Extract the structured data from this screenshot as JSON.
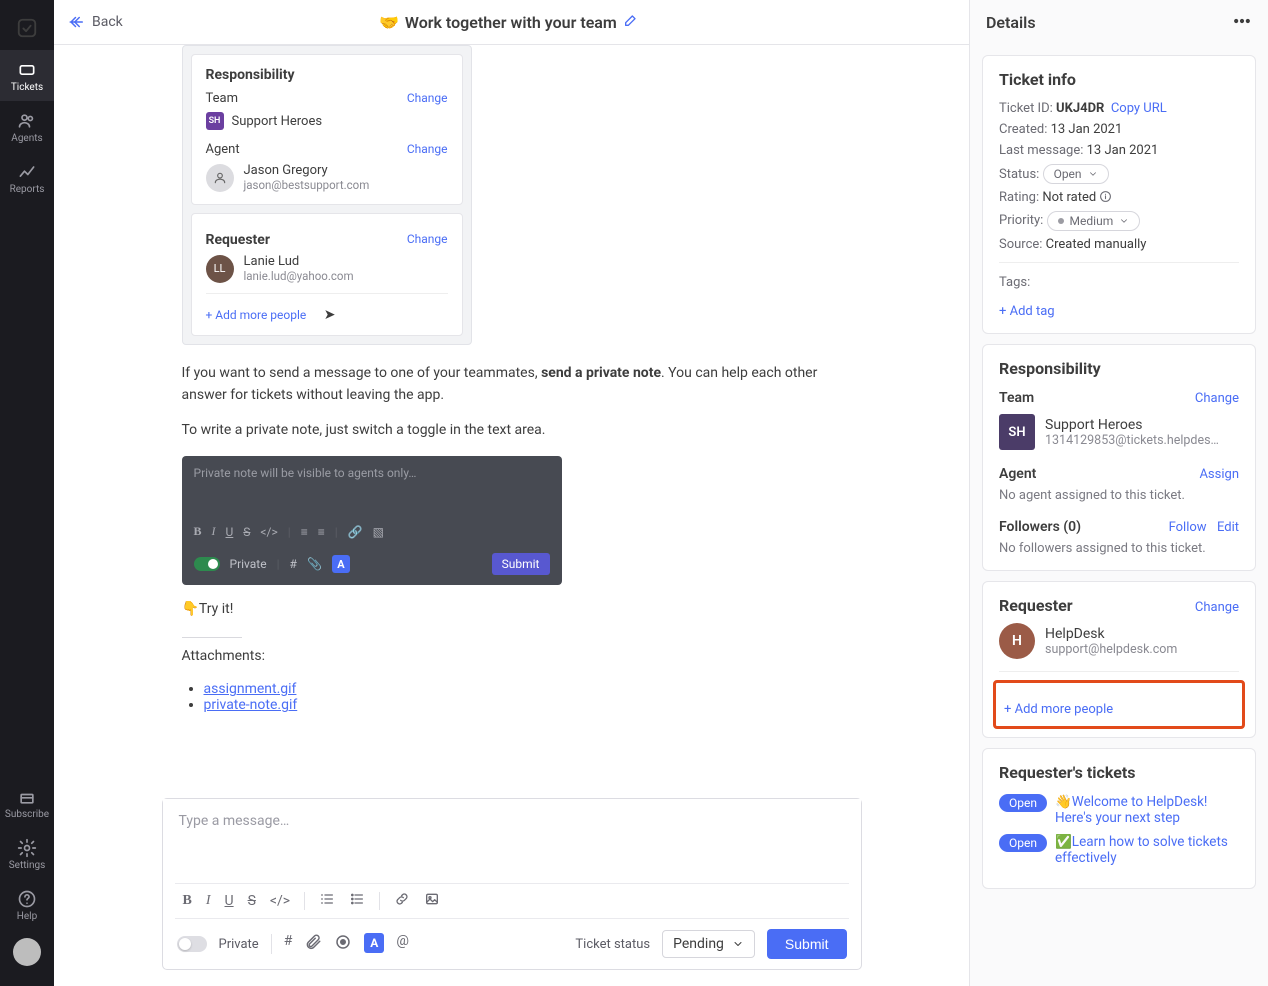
{
  "nav": {
    "items": [
      {
        "label": "Tickets"
      },
      {
        "label": "Agents"
      },
      {
        "label": "Reports"
      }
    ],
    "bottom": [
      {
        "label": "Subscribe"
      },
      {
        "label": "Settings"
      },
      {
        "label": "Help"
      }
    ]
  },
  "header": {
    "back": "Back",
    "emoji": "🤝",
    "title": "Work together with your team"
  },
  "embed1": {
    "heading": "Responsibility",
    "team_label": "Team",
    "team_name": "Support Heroes",
    "team_initials": "SH",
    "agent_label": "Agent",
    "agent_name": "Jason Gregory",
    "agent_email": "jason@bestsupport.com",
    "change": "Change"
  },
  "embed2": {
    "heading": "Requester",
    "name": "Lanie Lud",
    "initials": "LL",
    "email": "lanie.lud@yahoo.com",
    "change": "Change",
    "add_more": "+ Add more people"
  },
  "prose": {
    "p1a": "If you want to send a message to one of your teammates, ",
    "p1b": "send a private note",
    "p1c": ". You can help each other answer for tickets without leaving the app.",
    "p2": "To write a private note, just switch a toggle in the text area.",
    "try": "👇Try it!"
  },
  "private_box": {
    "placeholder": "Private note will be visible to agents only…",
    "private_label": "Private",
    "submit": "Submit"
  },
  "attachments": {
    "label": "Attachments:",
    "files": [
      "assignment.gif",
      "private-note.gif"
    ]
  },
  "composer": {
    "placeholder": "Type a message…",
    "private_label": "Private",
    "status_label": "Ticket status",
    "status_value": "Pending",
    "submit": "Submit"
  },
  "details": {
    "title": "Details",
    "ticket_info": {
      "heading": "Ticket info",
      "id_label": "Ticket ID:",
      "id_value": "UKJ4DR",
      "copy_url": "Copy URL",
      "created_label": "Created:",
      "created_value": "13 Jan 2021",
      "last_label": "Last message:",
      "last_value": "13 Jan 2021",
      "status_label": "Status:",
      "status_value": "Open",
      "rating_label": "Rating:",
      "rating_value": "Not rated",
      "priority_label": "Priority:",
      "priority_value": "Medium",
      "source_label": "Source:",
      "source_value": "Created manually",
      "tags_label": "Tags:",
      "add_tag": "+ Add tag"
    },
    "responsibility": {
      "heading": "Responsibility",
      "team_label": "Team",
      "team_change": "Change",
      "team_initials": "SH",
      "team_name": "Support Heroes",
      "team_email": "1314129853@tickets.helpdesk.…",
      "agent_label": "Agent",
      "agent_assign": "Assign",
      "agent_none": "No agent assigned to this ticket.",
      "followers_label": "Followers (0)",
      "follow": "Follow",
      "edit": "Edit",
      "followers_none": "No followers assigned to this ticket."
    },
    "requester": {
      "heading": "Requester",
      "change": "Change",
      "initial": "H",
      "name": "HelpDesk",
      "email": "support@helpdesk.com",
      "add_more": "+ Add more people"
    },
    "req_tickets": {
      "heading": "Requester's tickets",
      "open": "Open",
      "t1": "👋Welcome to HelpDesk! Here's your next step",
      "t2": "✅Learn how to solve tickets effectively"
    }
  }
}
